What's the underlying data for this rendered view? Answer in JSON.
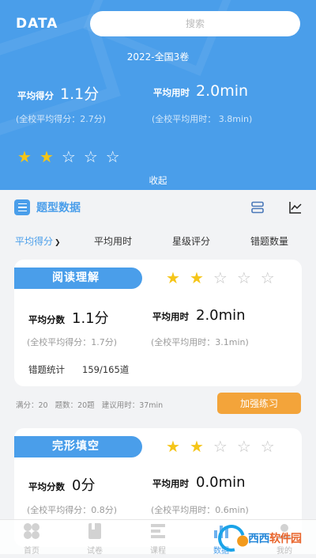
{
  "header": {
    "brand": "DATA",
    "search_placeholder": "搜索",
    "exam": "2022-全国3卷",
    "avg_score_label": "平均得分",
    "avg_score_value": "1.1分",
    "avg_time_label": "平均用时",
    "avg_time_value": "2.0min",
    "school_score": "(全校平均得分：2.7分)",
    "school_time": "(全校平均用时：  3.8min)",
    "stars_filled": 2,
    "stars_total": 5,
    "collapse": "收起"
  },
  "section": {
    "title": "题型数据",
    "icons": [
      "list-view-icon",
      "line-chart-icon"
    ]
  },
  "tabs": [
    {
      "label": "平均得分",
      "active": true
    },
    {
      "label": "平均用时",
      "active": false
    },
    {
      "label": "星级评分",
      "active": false
    },
    {
      "label": "错题数量",
      "active": false
    }
  ],
  "cards": [
    {
      "title": "阅读理解",
      "stars_filled": 2,
      "score_label": "平均分数",
      "score_value": "1.1分",
      "time_label": "平均用时",
      "time_value": "2.0min",
      "school_score": "(全校平均得分：1.7分)",
      "school_time": "(全校平均用时：3.1min)",
      "wrong_label": "错题统计",
      "wrong_value": "159/165道"
    },
    {
      "title": "完形填空",
      "stars_filled": 2,
      "score_label": "平均分数",
      "score_value": "0分",
      "time_label": "平均用时",
      "time_value": "0.0min",
      "school_score": "(全校平均得分：0.8分)",
      "school_time": "(全校平均用时：0.6min)"
    }
  ],
  "card_meta": {
    "full": "满分：20",
    "count": "题数：20题",
    "suggest": "建议用时：37min",
    "practice_button": "加强练习"
  },
  "nav": [
    {
      "label": "首页",
      "icon": "home-grid-icon",
      "active": false
    },
    {
      "label": "试卷",
      "icon": "paper-icon",
      "active": false
    },
    {
      "label": "课程",
      "icon": "course-icon",
      "active": false
    },
    {
      "label": "数据",
      "icon": "data-icon",
      "active": true
    },
    {
      "label": "我的",
      "icon": "profile-icon",
      "active": false
    }
  ],
  "watermark": {
    "text_a": "西西",
    "text_b": "软件园"
  },
  "colors": {
    "primary": "#4a9eea",
    "star": "#f5c518",
    "accent": "#f3a43a"
  }
}
